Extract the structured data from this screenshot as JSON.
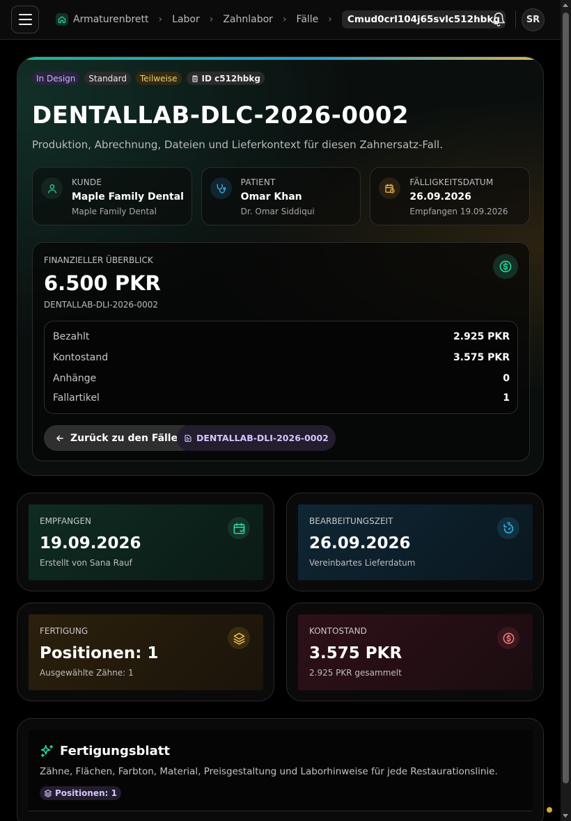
{
  "header": {
    "breadcrumbs": [
      "Armaturenbrett",
      "Labor",
      "Zahnlabor",
      "Fälle"
    ],
    "current": "Cmud0crl104j65svlc512hbkg",
    "avatar_initials": "SR"
  },
  "hero": {
    "chips": {
      "status": "In Design",
      "priority": "Standard",
      "payment": "Teilweise",
      "id": "ID c512hbkg"
    },
    "title": "DENTALLAB-DLC-2026-0002",
    "subtitle": "Produktion, Abrechnung, Dateien und Lieferkontext für diesen Zahnersatz-Fall.",
    "info": {
      "customer": {
        "label": "Kunde",
        "value": "Maple Family Dental",
        "sub": "Maple Family Dental"
      },
      "patient": {
        "label": "Patient",
        "value": "Omar Khan",
        "sub": "Dr. Omar Siddiqui"
      },
      "due": {
        "label": "Fälligkeitsdatum",
        "value": "26.09.2026",
        "sub": "Empfangen 19.09.2026"
      }
    },
    "finance": {
      "label": "Finanzieller Überblick",
      "amount": "6.500 PKR",
      "reference": "DENTALLAB-DLI-2026-0002",
      "rows": [
        {
          "key": "Bezahlt",
          "value": "2.925 PKR"
        },
        {
          "key": "Kontostand",
          "value": "3.575 PKR"
        },
        {
          "key": "Anhänge",
          "value": "0"
        },
        {
          "key": "Fallartikel",
          "value": "1"
        }
      ],
      "back_button": "Zurück zu den Fällen",
      "invoice_button": "DENTALLAB-DLI-2026-0002"
    }
  },
  "stats": {
    "received": {
      "label": "Empfangen",
      "value": "19.09.2026",
      "sub": "Erstellt von Sana Rauf"
    },
    "turnaround": {
      "label": "Bearbeitungszeit",
      "value": "26.09.2026",
      "sub": "Vereinbartes Lieferdatum"
    },
    "production": {
      "label": "Fertigung",
      "value": "Positionen: 1",
      "sub": "Ausgewählte Zähne: 1"
    },
    "balance": {
      "label": "Kontostand",
      "value": "3.575 PKR",
      "sub": "2.925 PKR gesammelt"
    }
  },
  "sheet": {
    "title": "Fertigungsblatt",
    "subtitle": "Zähne, Flächen, Farbton, Material, Preisgestaltung und Laborhinweise für jede Restaurationslinie.",
    "chip": "Positionen: 1"
  },
  "colors": {
    "accent_green": "#2fd39b",
    "accent_blue": "#34b6e6",
    "accent_gold": "#e7b84a",
    "accent_red": "#f08080",
    "accent_purple": "#c7b6ff"
  }
}
